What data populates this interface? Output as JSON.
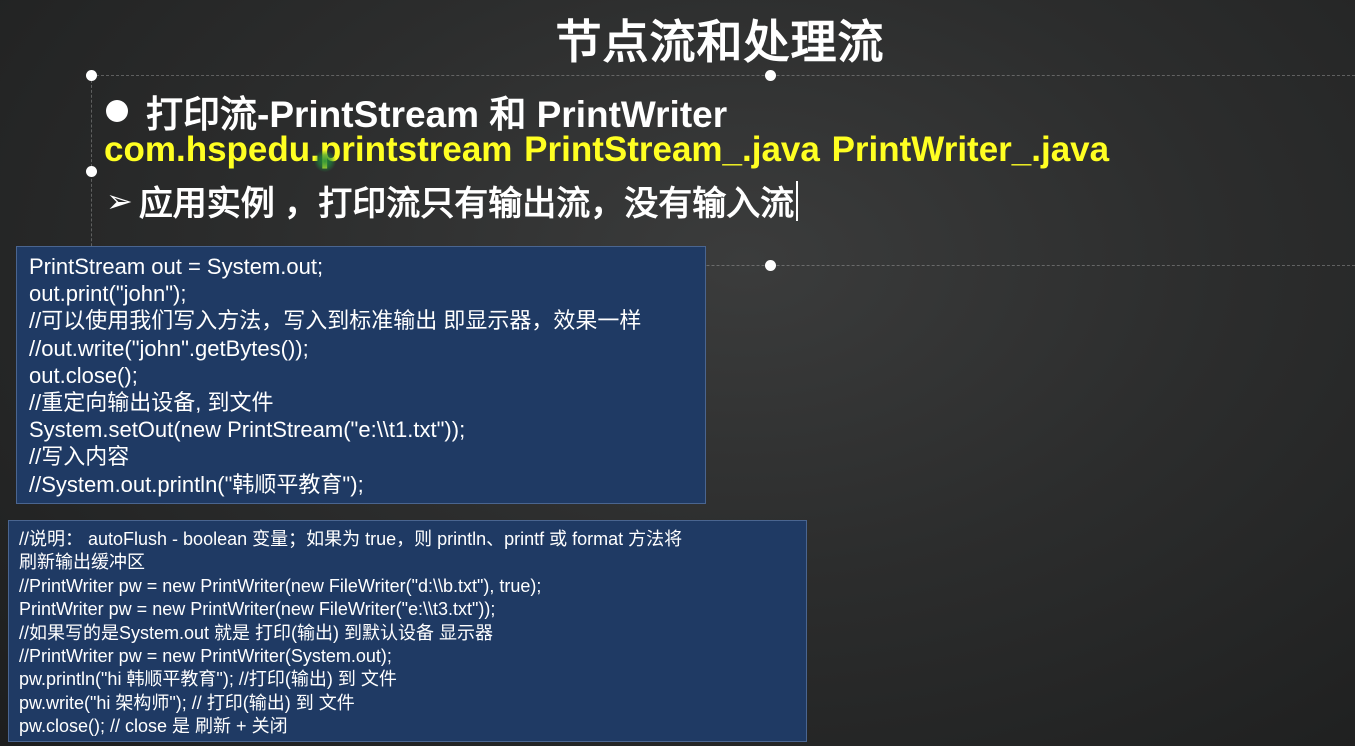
{
  "slide": {
    "title": "节点流和处理流",
    "heading": "打印流-PrintStream 和 PrintWriter",
    "package_line": "com.hspedu.printstream  PrintStream_.java PrintWriter_.java",
    "example_arrow": "➢",
    "example_text": "应用实例 ，打印流只有输出流，没有输入流"
  },
  "code_block_1": {
    "lines": [
      "PrintStream out = System.out;",
      "out.print(\"john\");",
      "//可以使用我们写入方法，写入到标准输出 即显示器，效果一样",
      "//out.write(\"john\".getBytes());",
      "out.close();",
      "//重定向输出设备, 到文件",
      "System.setOut(new PrintStream(\"e:\\\\t1.txt\"));",
      "//写入内容",
      "//System.out.println(\"韩顺平教育\");"
    ]
  },
  "code_block_2": {
    "lines": [
      "//说明：  autoFlush - boolean 变量；如果为 true，则 println、printf 或 format 方法将",
      "刷新输出缓冲区",
      "//PrintWriter pw = new PrintWriter(new FileWriter(\"d:\\\\b.txt\"), true);",
      "PrintWriter pw = new PrintWriter(new FileWriter(\"e:\\\\t3.txt\"));",
      "//如果写的是System.out 就是 打印(输出) 到默认设备 显示器",
      "//PrintWriter pw = new PrintWriter(System.out);",
      "pw.println(\"hi 韩顺平教育\"); //打印(输出) 到 文件",
      "pw.write(\"hi 架构师\"); // 打印(输出) 到 文件",
      "pw.close();  // close 是 刷新 + 关闭"
    ]
  },
  "colors": {
    "background": "#2c2d2d",
    "title_text": "#ffffff",
    "package_text": "#ffff22",
    "code_box_bg": "#1f3a64",
    "laser_pointer": "#1e8c3c"
  },
  "icons": {
    "bullet": "filled-circle",
    "example_marker": "arrow-right-icon",
    "selection_handles": "circle-handle"
  }
}
